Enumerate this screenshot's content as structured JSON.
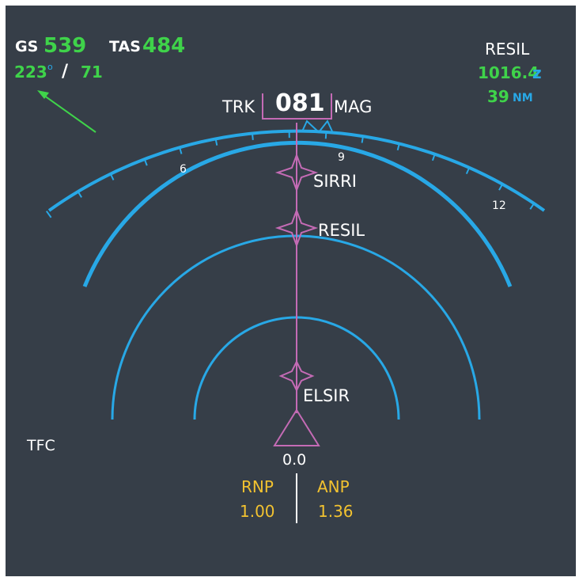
{
  "colors": {
    "background": "#363e48",
    "white": "#ffffff",
    "green": "#3fd34a",
    "cyan": "#28a8e6",
    "magenta": "#c46bb5",
    "amber": "#f2c230"
  },
  "groundspeed": {
    "label": "GS",
    "value": "539"
  },
  "true_airspeed": {
    "label": "TAS",
    "value": "484"
  },
  "wind": {
    "direction": "223",
    "degree_symbol": "o",
    "separator": "/",
    "speed": "71",
    "arrow_icon": "wind-arrow"
  },
  "heading": {
    "track_label": "TRK",
    "value": "081",
    "reference": "MAG"
  },
  "active_waypoint": {
    "name": "RESIL",
    "eta": "1016.4",
    "eta_suffix": "z",
    "distance": "39",
    "distance_unit": "NM"
  },
  "compass": {
    "labels": [
      "6",
      "9",
      "12"
    ]
  },
  "route": {
    "waypoints": [
      "SIRRI",
      "RESIL",
      "ELSIR"
    ],
    "waypoint_icon": "waypoint-star",
    "aircraft_icon": "aircraft-triangle"
  },
  "range_value": "0.0",
  "traffic_label": "TFC",
  "rnp": {
    "label": "RNP",
    "value": "1.00"
  },
  "anp": {
    "label": "ANP",
    "value": "1.36"
  }
}
